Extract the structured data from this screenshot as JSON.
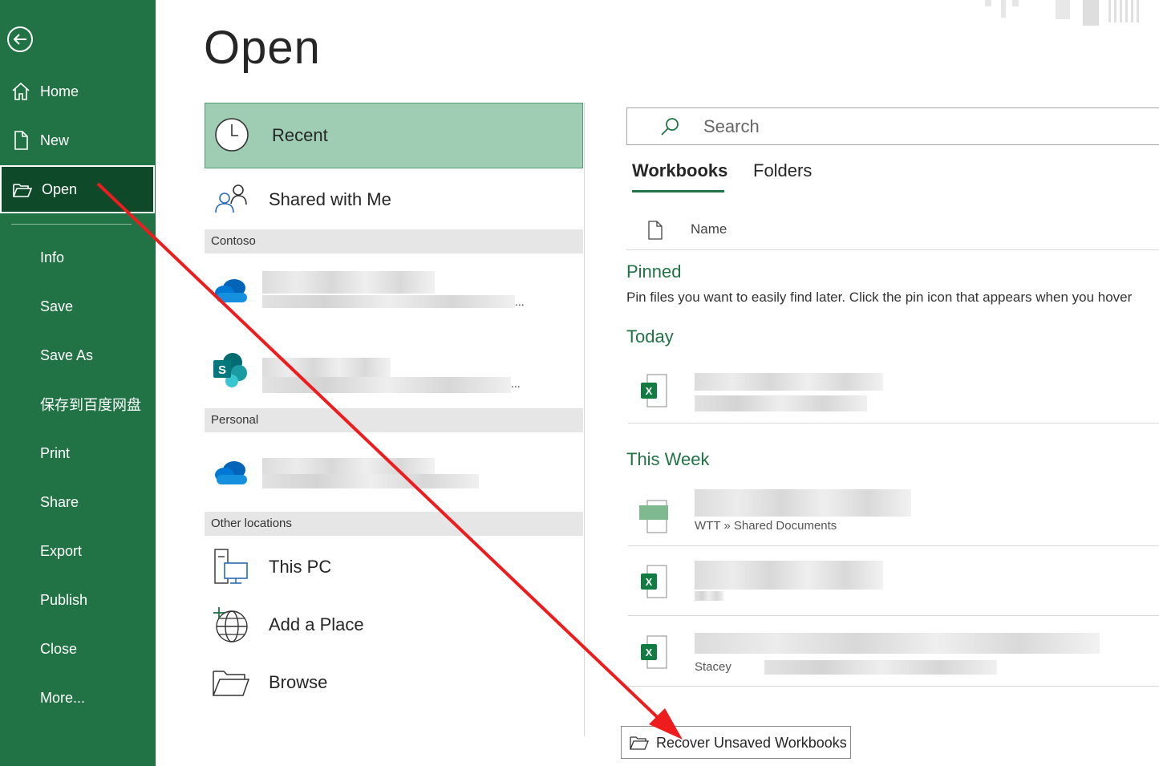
{
  "sidebar": {
    "items": [
      {
        "label": "Home"
      },
      {
        "label": "New"
      },
      {
        "label": "Open"
      },
      {
        "label": "Info"
      },
      {
        "label": "Save"
      },
      {
        "label": "Save As"
      },
      {
        "label": "保存到百度网盘"
      },
      {
        "label": "Print"
      },
      {
        "label": "Share"
      },
      {
        "label": "Export"
      },
      {
        "label": "Publish"
      },
      {
        "label": "Close"
      },
      {
        "label": "More..."
      }
    ],
    "active": "Open",
    "bg_color": "#217346",
    "active_color": "#0e4a2a"
  },
  "page": {
    "title": "Open"
  },
  "locations": {
    "recent_label": "Recent",
    "shared_label": "Shared with Me",
    "sections": {
      "contoso": "Contoso",
      "personal": "Personal",
      "other": "Other locations"
    },
    "ellipsis_1": "...",
    "ellipsis_2": "...",
    "this_pc_label": "This PC",
    "add_place_label": "Add a Place",
    "browse_label": "Browse"
  },
  "search": {
    "placeholder": "Search"
  },
  "tabs": {
    "workbooks": "Workbooks",
    "folders": "Folders"
  },
  "list": {
    "name_header": "Name",
    "pinned_title": "Pinned",
    "pinned_desc": "Pin files you want to easily find later. Click the pin icon that appears when you hover",
    "today_title": "Today",
    "this_week_title": "This Week",
    "week_path_1": "WTT » Shared Documents",
    "week_path_3": "Stacey"
  },
  "recover": {
    "label": "Recover Unsaved Workbooks"
  },
  "icons": {
    "back": "back-arrow-icon",
    "home": "home-icon",
    "new": "new-document-icon",
    "open": "open-folder-icon"
  },
  "annotation": {
    "arrow_color": "#ee1c1c"
  }
}
